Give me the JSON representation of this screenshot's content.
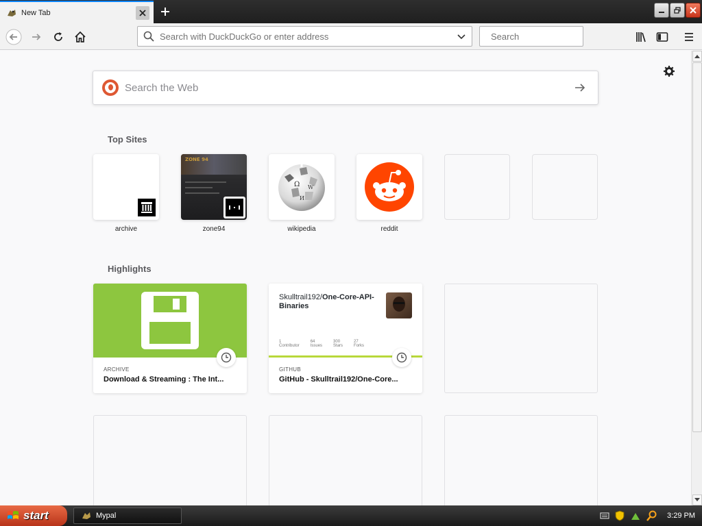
{
  "window": {
    "tab_title": "New Tab",
    "taskbar_app": "Mypal",
    "clock": "3:29 PM",
    "start_label": "start"
  },
  "toolbar": {
    "url_placeholder": "Search with DuckDuckGo or enter address",
    "search_placeholder": "Search"
  },
  "newtab": {
    "web_search_placeholder": "Search the Web",
    "top_sites_heading": "Top Sites",
    "highlights_heading": "Highlights",
    "top_sites": [
      {
        "label": "archive",
        "icon": "archive-icon"
      },
      {
        "label": "zone94",
        "icon": "zone94-thumbnail"
      },
      {
        "label": "wikipedia",
        "icon": "wikipedia-globe-icon"
      },
      {
        "label": "reddit",
        "icon": "reddit-alien-icon"
      },
      {
        "label": "",
        "icon": ""
      },
      {
        "label": "",
        "icon": ""
      }
    ],
    "highlights": [
      {
        "source": "ARCHIVE",
        "title": "Download & Streaming : The Int...",
        "color": "#8dc63f"
      },
      {
        "source": "GITHUB",
        "title": "GitHub - Skulltrail192/One-Core...",
        "repo_owner": "Skulltrail192/",
        "repo_name": "One-Core-API-Binaries",
        "stats": [
          "1",
          "64",
          "300",
          "27"
        ],
        "stat_labels": [
          "Contributor",
          "Issues",
          "Stars",
          "Forks"
        ]
      }
    ]
  },
  "colors": {
    "accent": "#0a84ff",
    "archive_green": "#8dc63f",
    "reddit_orange": "#ff4500",
    "ddg_orange": "#de5833"
  }
}
